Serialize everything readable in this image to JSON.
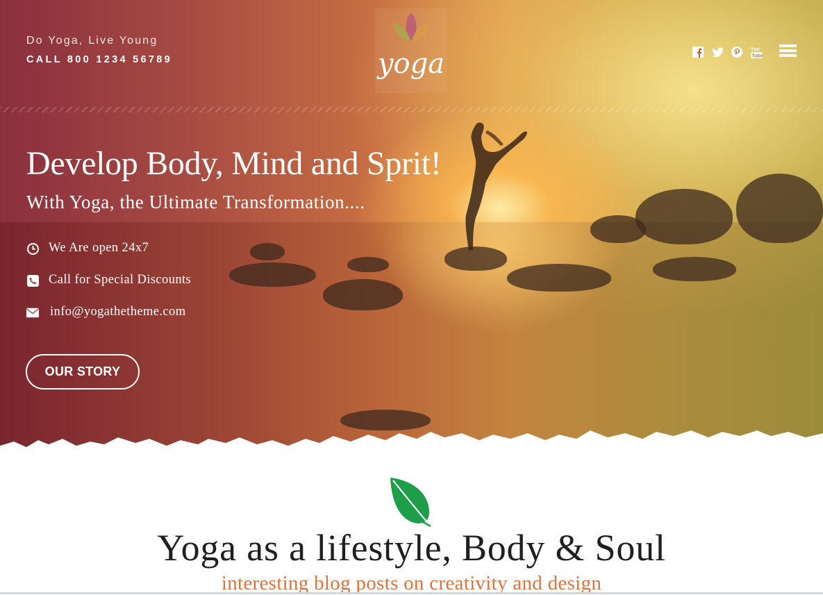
{
  "header": {
    "tagline": "Do Yoga, Live Young",
    "phone": "CALL 800 1234 56789",
    "logo_text": "yoga",
    "social": [
      {
        "name": "facebook-icon"
      },
      {
        "name": "twitter-icon"
      },
      {
        "name": "pinterest-icon"
      },
      {
        "name": "youtube-icon"
      }
    ],
    "menu_icon": "hamburger-menu-icon"
  },
  "hero": {
    "headline": "Develop Body, Mind and Sprit!",
    "subheadline": "With Yoga, the Ultimate Transformation....",
    "info": [
      {
        "icon": "clock-icon",
        "text": "We Are open 24x7"
      },
      {
        "icon": "phone-icon",
        "text": "Call for Special Discounts"
      },
      {
        "icon": "envelope-icon",
        "text": "info@yogathetheme.com"
      }
    ],
    "cta_label": "OUR STORY"
  },
  "section": {
    "icon": "leaf-icon",
    "title": "Yoga as a lifestyle, Body & Soul",
    "subtitle": "interesting blog posts on creativity and design"
  },
  "colors": {
    "accent_orange": "#e2713c",
    "leaf_green": "#1f9e4a",
    "hero_left": "#8a2f3e",
    "hero_right": "#a39b45"
  }
}
